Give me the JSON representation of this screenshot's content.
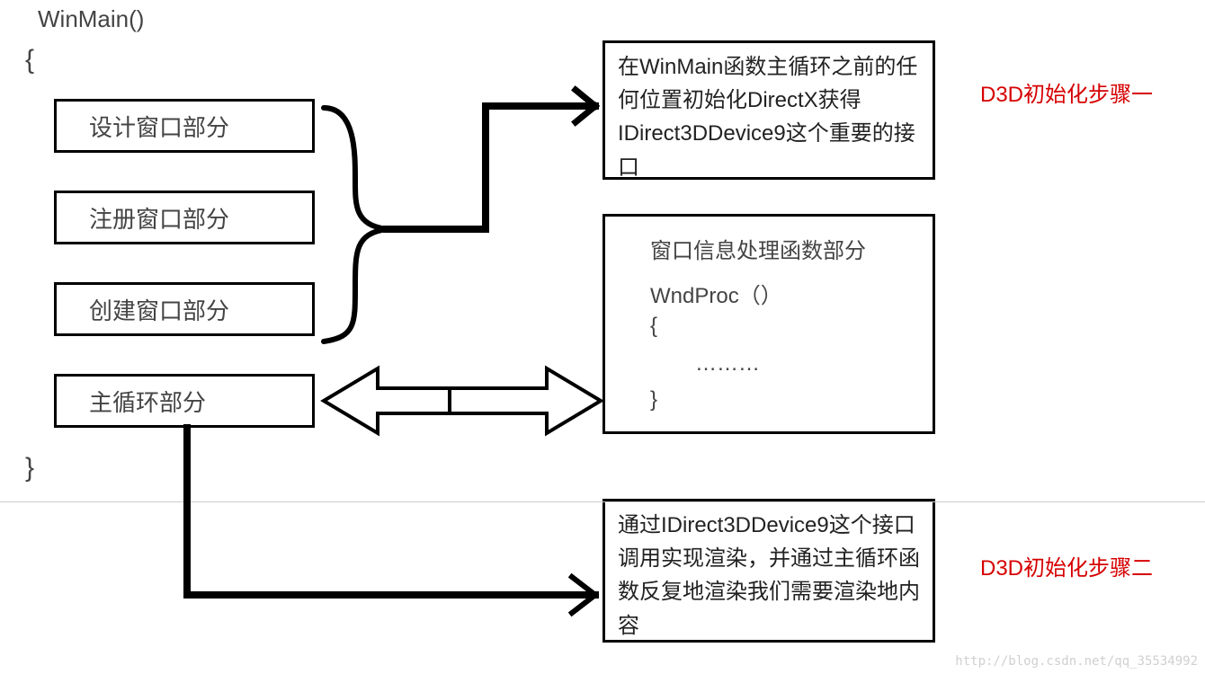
{
  "header": {
    "func_name": "WinMain()",
    "open_brace": "{",
    "close_brace": "}"
  },
  "left_boxes": {
    "design_window": "设计窗口部分",
    "register_window": "注册窗口部分",
    "create_window": "创建窗口部分",
    "main_loop": "主循环部分"
  },
  "right_boxes": {
    "step1_text": "在WinMain函数主循环之前的任何位置初始化DirectX获得IDirect3DDevice9这个重要的接口",
    "wndproc_title": "窗口信息处理函数部分",
    "wndproc_func": "WndProc（）",
    "wndproc_open": "{",
    "wndproc_dots": "………",
    "wndproc_close": "}",
    "step2_text": "通过IDirect3DDevice9这个接口调用实现渲染，并通过主循环函数反复地渲染我们需要渲染地内容"
  },
  "labels": {
    "step1": "D3D初始化步骤一",
    "step2": "D3D初始化步骤二"
  },
  "watermark": "http://blog.csdn.net/qq_35534992"
}
